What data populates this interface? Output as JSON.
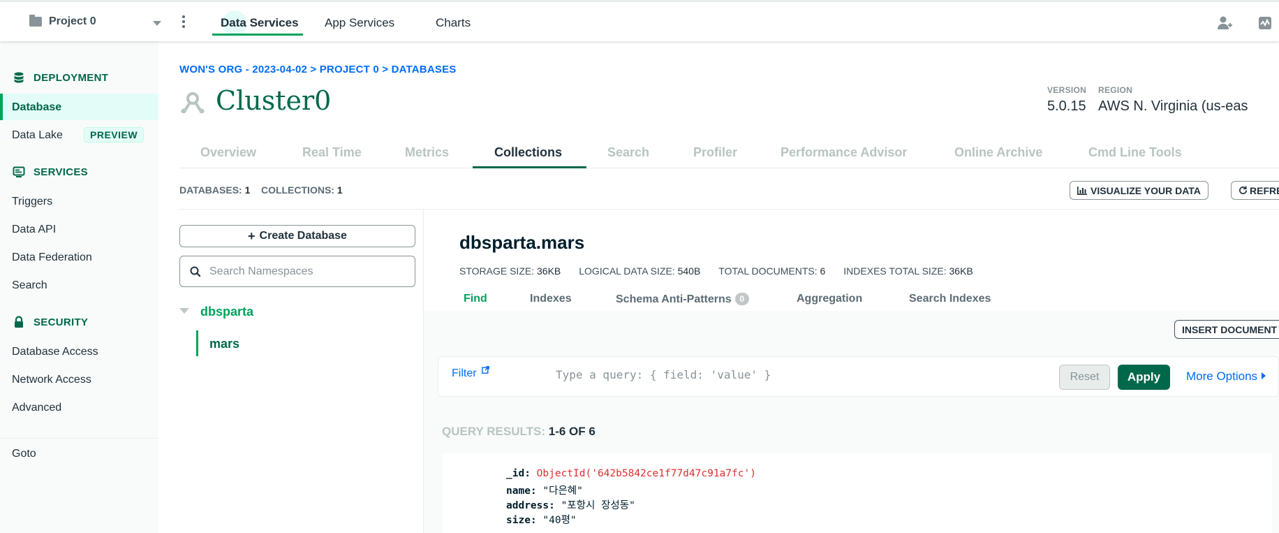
{
  "topbar": {
    "project_name": "Project 0",
    "tabs": [
      "Data Services",
      "App Services",
      "Charts"
    ],
    "active_tab": "Data Services"
  },
  "sidebar": {
    "deployment_header": "DEPLOYMENT",
    "deployment_items": [
      "Database",
      "Data Lake"
    ],
    "preview_badge": "PREVIEW",
    "services_header": "SERVICES",
    "services_items": [
      "Triggers",
      "Data API",
      "Data Federation",
      "Search"
    ],
    "security_header": "SECURITY",
    "security_items": [
      "Database Access",
      "Network Access",
      "Advanced"
    ],
    "goto": "Goto"
  },
  "breadcrumb": "WON'S ORG - 2023-04-02 > PROJECT 0 > DATABASES",
  "cluster": {
    "name": "Cluster0",
    "version_label": "VERSION",
    "version": "5.0.15",
    "region_label": "REGION",
    "region": "AWS N. Virginia (us-eas"
  },
  "cluster_tabs": [
    "Overview",
    "Real Time",
    "Metrics",
    "Collections",
    "Search",
    "Profiler",
    "Performance Advisor",
    "Online Archive",
    "Cmd Line Tools"
  ],
  "active_cluster_tab": "Collections",
  "counts": {
    "databases_label": "DATABASES:",
    "databases": "1",
    "collections_label": "COLLECTIONS:",
    "collections": "1"
  },
  "buttons": {
    "visualize": "VISUALIZE YOUR DATA",
    "refresh": "REFRE",
    "create_database": "Create Database",
    "insert_document": "INSERT DOCUMENT",
    "reset": "Reset",
    "apply": "Apply",
    "more_options": "More Options"
  },
  "namespace_search": {
    "placeholder": "Search Namespaces"
  },
  "tree": {
    "database": "dbsparta",
    "collection": "mars"
  },
  "namespace": {
    "title": "dbsparta.mars",
    "storage_label": "STORAGE SIZE:",
    "storage": "36KB",
    "logical_label": "LOGICAL DATA SIZE:",
    "logical": "540B",
    "total_docs_label": "TOTAL DOCUMENTS:",
    "total_docs": "6",
    "indexes_label": "INDEXES TOTAL SIZE:",
    "indexes": "36KB"
  },
  "sub_tabs": [
    "Find",
    "Indexes",
    "Schema Anti-Patterns",
    "Aggregation",
    "Search Indexes"
  ],
  "anti_patterns_count": "0",
  "filter": {
    "label": "Filter",
    "placeholder": "Type a query: { field: 'value' }"
  },
  "query_results": {
    "label": "QUERY RESULTS:",
    "value": "1-6 OF 6"
  },
  "document": {
    "id_key": "_id:",
    "id_value": "ObjectId('642b5842ce1f77d47c91a7fc')",
    "name_key": "name:",
    "name_value": "\"다은혜\"",
    "address_key": "address:",
    "address_value": "\"포항시 장성동\"",
    "size_key": "size:",
    "size_value": "\"40평\""
  },
  "colors": {
    "accent_green": "#00684a",
    "bright_green": "#00a35c",
    "link_blue": "#016bf8",
    "objectid_red": "#db3030"
  },
  "icons": [
    "folder-icon",
    "chevron-down-icon",
    "kebab-icon",
    "add-user-icon",
    "activity-icon",
    "database-icon",
    "services-icon",
    "lock-icon",
    "cluster-icon",
    "bar-chart-icon",
    "refresh-icon",
    "plus-icon",
    "search-icon",
    "external-link-icon",
    "caret-right-icon"
  ]
}
